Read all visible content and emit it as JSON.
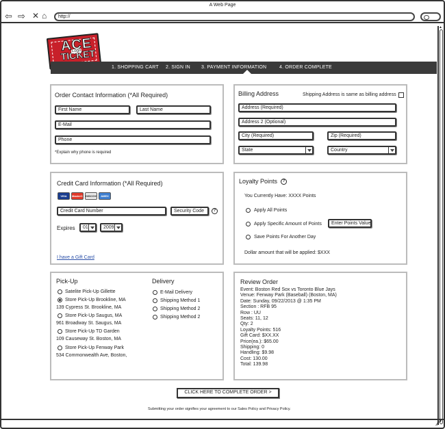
{
  "browser": {
    "title": "A Web Page",
    "url": "http://"
  },
  "logo": {
    "text_top": "ACE",
    "text_bottom": "TICKET",
    "label": "Logo"
  },
  "steps": [
    {
      "label": "1. SHOPPING CART"
    },
    {
      "label": "2. SIGN IN"
    },
    {
      "label": "3. PAYMENT INFORMATION"
    },
    {
      "label": "4. ORDER COMPLETE"
    }
  ],
  "contact": {
    "title": "Order Contact Information (*All Required)",
    "first_name": "First Name",
    "last_name": "Last Name",
    "email": "E-Mail",
    "phone": "Phone",
    "note": "*Explain why phone is required"
  },
  "billing": {
    "title": "Billing Address",
    "same_label": "Shipping Address is same as billing address",
    "address": "Address (Required)",
    "address2": "Address 2 (Optional)",
    "city": "City (Required)",
    "zip": "Zip (Required)",
    "state": "State",
    "country": "Country"
  },
  "credit": {
    "title": "Credit Card Information  (*All Required)",
    "cards": [
      "VISA",
      "MasterCard",
      "DISCOVER",
      "AMEX"
    ],
    "card_number": "Credit Card Number",
    "security_code": "Security Code",
    "expires_label": "Expires",
    "exp_month": "01",
    "exp_year": "2009",
    "gift_card": "I have a Gift Card"
  },
  "loyalty": {
    "title": "Loyalty Points",
    "current": "You Currently Have: XXXX Points",
    "options": [
      {
        "label": "Apply All Points"
      },
      {
        "label": "Apply Specific Amount of Points"
      },
      {
        "label": "Save Points For Another Day"
      }
    ],
    "enter_points": "Enter Points Value",
    "dollar_amount": "Dollar amount that will be applied: $XXX"
  },
  "pickup": {
    "title": "Pick-Up",
    "options": [
      {
        "label": "Satelite Pick-Up Gillette",
        "address": ""
      },
      {
        "label": "Store Pick-Up Brookline, MA",
        "address": "139 Cypress St. Brookline, MA"
      },
      {
        "label": "Store Pick-Up Saugus, MA",
        "address": "961 Broadway St. Saugus, MA"
      },
      {
        "label": "Store Pick-Up TD Garden",
        "address": "109 Causeway St. Boston, MA"
      },
      {
        "label": "Store Pick-Up Fenway Park",
        "address": "534 Commonwealth Ave, Boston,"
      }
    ]
  },
  "delivery": {
    "title": "Delivery",
    "options": [
      {
        "label": "E-Mail Delivery"
      },
      {
        "label": "Shipping Method 1"
      },
      {
        "label": "Shipping Method 2"
      },
      {
        "label": "Shipping Method 2"
      }
    ]
  },
  "review": {
    "title": "Review Order",
    "lines": [
      "Event:  Boston Red Sox vs Toronto Blue Jays",
      "Venue:  Fenway Park (Baseball) (Boston, MA)",
      "Date:  Sunday, 09/22/2013 @ 1:35 PM",
      "Section : RFB 95",
      "Row : UU",
      "Seats: 11, 12",
      "Qty: 2",
      "Loyalty Points: 516",
      "Gift Card: $XX.XX",
      "Price(ea.): $65.00",
      "Shipping: 0",
      "Handling: $9.98",
      "Cost: 130.00",
      "Total: 139.98"
    ]
  },
  "footer": {
    "complete_button": "CLICK HERE TO COMPLETE ORDER >",
    "agreement": "Submitting your order signifies your agreement to our Sales Policy and Privacy Policy."
  },
  "colors": {
    "step_bar": "#3a3a3a",
    "logo_red": "#c8202a",
    "link": "#2a4fa8"
  }
}
